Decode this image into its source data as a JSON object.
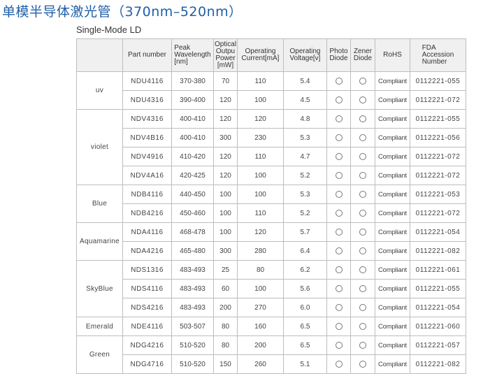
{
  "title": "单模半导体激光管（370nm–520nm）",
  "subtitle": "Single-Mode LD",
  "headers": {
    "part_number": "Part number",
    "peak_wavelength": [
      "Peak",
      "Wavelength",
      "[nm]"
    ],
    "optical_power": [
      "Optical",
      "Outpu",
      "Power",
      "[mW]"
    ],
    "operating_current": [
      "Operating",
      "Current[mA]"
    ],
    "operating_voltage": [
      "Operating",
      "Voltage[v]"
    ],
    "photo_diode": [
      "Photo",
      "Diode"
    ],
    "zener_diode": [
      "Zener",
      "Diode"
    ],
    "rohs": "RoHS",
    "fda": [
      "FDA",
      "Accession",
      "Number"
    ]
  },
  "groups": [
    {
      "name": "uv",
      "rows": [
        {
          "part": "NDU4116",
          "wavelength": "370-380",
          "power": "70",
          "current": "110",
          "voltage": "5.4",
          "rohs": "Compliant",
          "fda": "0112221-055"
        },
        {
          "part": "NDU4316",
          "wavelength": "390-400",
          "power": "120",
          "current": "100",
          "voltage": "4.5",
          "rohs": "Compliant",
          "fda": "0112221-072"
        }
      ]
    },
    {
      "name": "violet",
      "rows": [
        {
          "part": "NDV4316",
          "wavelength": "400-410",
          "power": "120",
          "current": "120",
          "voltage": "4.8",
          "rohs": "Compliant",
          "fda": "0112221-055"
        },
        {
          "part": "NDV4B16",
          "wavelength": "400-410",
          "power": "300",
          "current": "230",
          "voltage": "5.3",
          "rohs": "Compliant",
          "fda": "0112221-056"
        },
        {
          "part": "NDV4916",
          "wavelength": "410-420",
          "power": "120",
          "current": "110",
          "voltage": "4.7",
          "rohs": "Compliant",
          "fda": "0112221-072"
        },
        {
          "part": "NDV4A16",
          "wavelength": "420-425",
          "power": "120",
          "current": "100",
          "voltage": "5.2",
          "rohs": "Compliant",
          "fda": "0112221-072"
        }
      ]
    },
    {
      "name": "Blue",
      "rows": [
        {
          "part": "NDB4116",
          "wavelength": "440-450",
          "power": "100",
          "current": "100",
          "voltage": "5.3",
          "rohs": "Compliant",
          "fda": "0112221-053"
        },
        {
          "part": "NDB4216",
          "wavelength": "450-460",
          "power": "100",
          "current": "110",
          "voltage": "5.2",
          "rohs": "Compliant",
          "fda": "0112221-072"
        }
      ]
    },
    {
      "name": "Aquamarine",
      "rows": [
        {
          "part": "NDA4116",
          "wavelength": "468-478",
          "power": "100",
          "current": "120",
          "voltage": "5.7",
          "rohs": "Compliant",
          "fda": "0112221-054"
        },
        {
          "part": "NDA4216",
          "wavelength": "465-480",
          "power": "300",
          "current": "280",
          "voltage": "6.4",
          "rohs": "Compliant",
          "fda": "0112221-082"
        }
      ]
    },
    {
      "name": "SkyBlue",
      "rows": [
        {
          "part": "NDS1316",
          "wavelength": "483-493",
          "power": "25",
          "current": "80",
          "voltage": "6.2",
          "rohs": "Compliant",
          "fda": "0112221-061"
        },
        {
          "part": "NDS4116",
          "wavelength": "483-493",
          "power": "60",
          "current": "100",
          "voltage": "5.6",
          "rohs": "Compliant",
          "fda": "0112221-055"
        },
        {
          "part": "NDS4216",
          "wavelength": "483-493",
          "power": "200",
          "current": "270",
          "voltage": "6.0",
          "rohs": "Compliant",
          "fda": "0112221-054"
        }
      ]
    },
    {
      "name": "Emerald",
      "rows": [
        {
          "part": "NDE4116",
          "wavelength": "503-507",
          "power": "80",
          "current": "160",
          "voltage": "6.5",
          "rohs": "Compliant",
          "fda": "0112221-060"
        }
      ]
    },
    {
      "name": "Green",
      "rows": [
        {
          "part": "NDG4216",
          "wavelength": "510-520",
          "power": "80",
          "current": "200",
          "voltage": "6.5",
          "rohs": "Compliant",
          "fda": "0112221-057"
        },
        {
          "part": "NDG4716",
          "wavelength": "510-520",
          "power": "150",
          "current": "260",
          "voltage": "5.1",
          "rohs": "Compliant",
          "fda": "0112221-082"
        }
      ]
    }
  ],
  "icons": {
    "photo_diode": "circle-icon",
    "zener_diode": "circle-icon"
  }
}
